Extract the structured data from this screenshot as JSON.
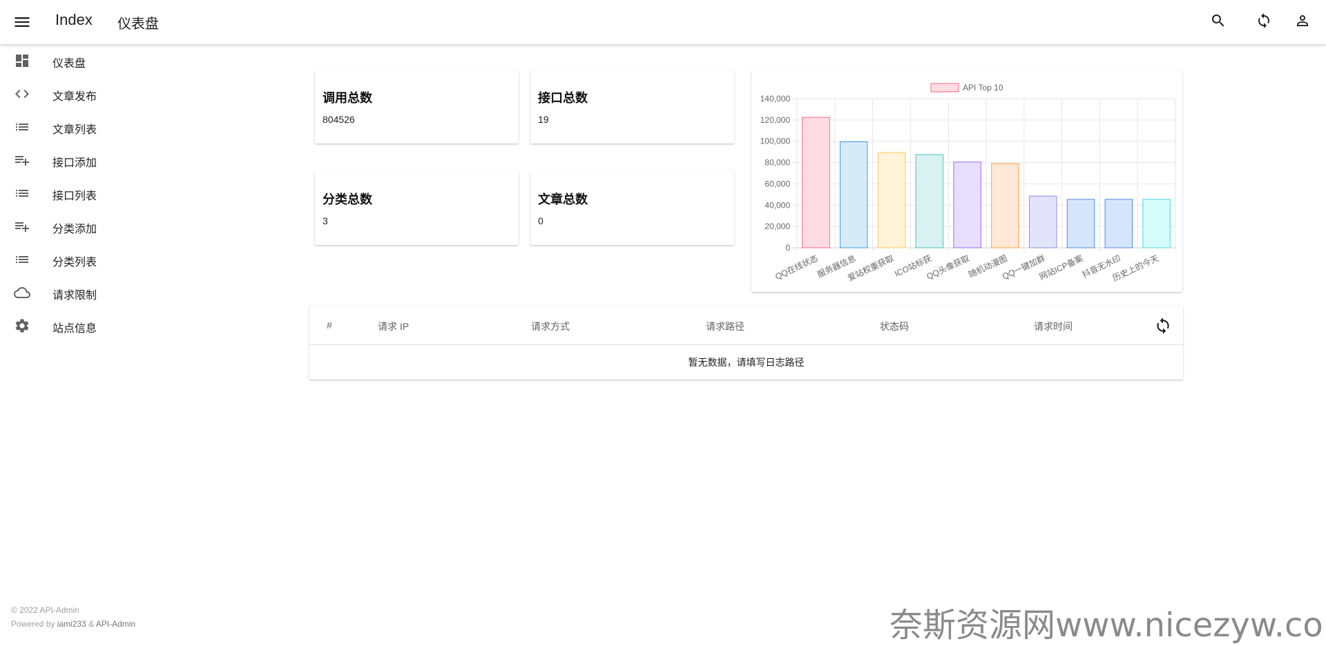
{
  "appbar": {
    "app_title": "Index",
    "page_title": "仪表盘",
    "icons": [
      "menu-icon",
      "search-icon",
      "sync-icon",
      "account-icon"
    ]
  },
  "sidebar": {
    "items": [
      {
        "label": "仪表盘",
        "icon": "dashboard-icon"
      },
      {
        "label": "文章发布",
        "icon": "code-icon"
      },
      {
        "label": "文章列表",
        "icon": "list-icon"
      },
      {
        "label": "接口添加",
        "icon": "playlist-add-icon"
      },
      {
        "label": "接口列表",
        "icon": "list-icon"
      },
      {
        "label": "分类添加",
        "icon": "playlist-add-icon"
      },
      {
        "label": "分类列表",
        "icon": "list-icon"
      },
      {
        "label": "请求限制",
        "icon": "cloud-icon"
      },
      {
        "label": "站点信息",
        "icon": "gear-icon"
      }
    ]
  },
  "footer": {
    "copyright": "© 2022 API-Admin",
    "powered_prefix": "Powered by ",
    "author": "iami233",
    "amp": " & ",
    "project": "API-Admin"
  },
  "stats": [
    {
      "title": "调用总数",
      "value": "804526"
    },
    {
      "title": "接口总数",
      "value": "19"
    },
    {
      "title": "分类总数",
      "value": "3"
    },
    {
      "title": "文章总数",
      "value": "0"
    }
  ],
  "chart_data": {
    "type": "bar",
    "title": "",
    "legend": {
      "label": "API Top 10",
      "position": "top"
    },
    "categories": [
      "QQ在线状态",
      "服务器信息",
      "爱站权重获取",
      "ICO站标获",
      "QQ头像获取",
      "随机动漫图",
      "QQ一键加群",
      "网站ICP备案",
      "抖音无水印",
      "历史上的今天"
    ],
    "values": [
      122500,
      99500,
      89500,
      87500,
      80500,
      79000,
      48500,
      45500,
      45500,
      45500
    ],
    "ylim": [
      0,
      140000
    ],
    "yticks": [
      "0",
      "20,000",
      "40,000",
      "60,000",
      "80,000",
      "100,000",
      "120,000",
      "140,000"
    ],
    "grid": true,
    "colors": [
      {
        "fill": "#ffdde3",
        "stroke": "#ff6384"
      },
      {
        "fill": "#d7eaf8",
        "stroke": "#36a2eb"
      },
      {
        "fill": "#fff3da",
        "stroke": "#ffcd56"
      },
      {
        "fill": "#d9f1f1",
        "stroke": "#4bc0c0"
      },
      {
        "fill": "#e8dfff",
        "stroke": "#9966ff"
      },
      {
        "fill": "#ffe8d5",
        "stroke": "#ff9f40"
      },
      {
        "fill": "#e3e3fb",
        "stroke": "#8b8bdf"
      },
      {
        "fill": "#d5e5fb",
        "stroke": "#4f8be6"
      },
      {
        "fill": "#d5e5fb",
        "stroke": "#4f8be6"
      },
      {
        "fill": "#d5fbfb",
        "stroke": "#4fd8e6"
      }
    ]
  },
  "table": {
    "headers": [
      "#",
      "请求 IP",
      "请求方式",
      "请求路径",
      "状态码",
      "请求时间"
    ],
    "empty_message": "暂无数据，请填写日志路径"
  },
  "watermark": "奈斯资源网www.nicezyw.com"
}
